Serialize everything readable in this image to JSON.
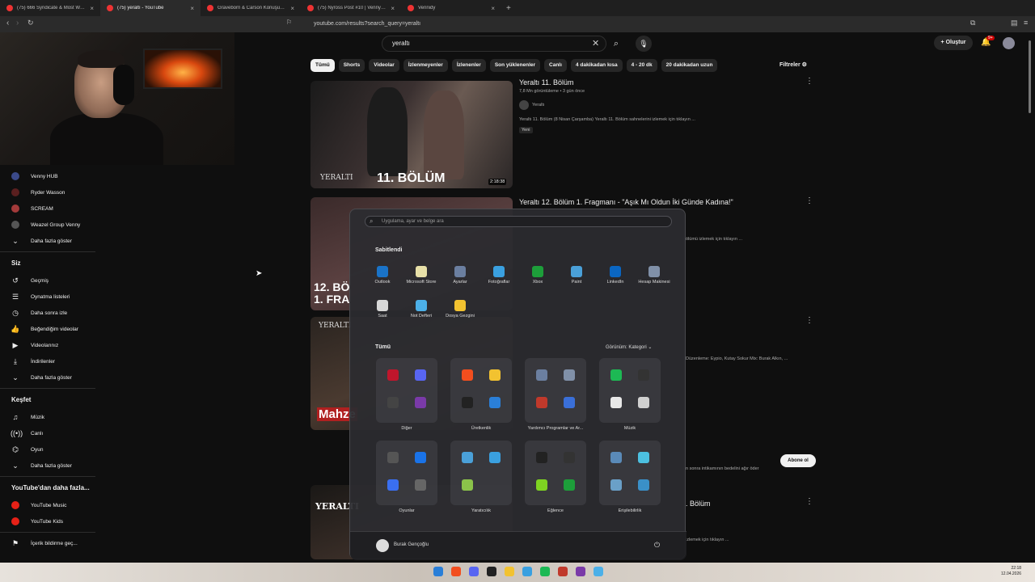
{
  "browser": {
    "tabs": [
      {
        "label": "(75) 666 Syndicate & Most Wanted | ...",
        "active": false
      },
      {
        "label": "(75) yeraltı - YouTube",
        "active": true
      },
      {
        "label": "Graveborn & Carson Konuşuyor! | R...",
        "active": false
      },
      {
        "label": "(75) Nyross Post #10 | VennyV - You...",
        "active": false
      },
      {
        "label": "Vennidy",
        "active": false
      }
    ],
    "url": "youtube.com/results?search_query=yeraltı"
  },
  "youtube": {
    "search_value": "yeraltı",
    "create_label": "Oluştur",
    "notifications_badge": "9+",
    "filter_chips": [
      "Tümü",
      "Shorts",
      "Videolar",
      "İzlenmeyenler",
      "İzlenenler",
      "Son yüklenenler",
      "Canlı",
      "4 dakikadan kısa",
      "4 - 20 dk",
      "20 dakikadan uzun"
    ],
    "filters_label": "Filtreler",
    "sidebar": {
      "subscriptions": [
        {
          "label": "Venny HUB",
          "color": "#3b4a8a"
        },
        {
          "label": "Ryder Wasson",
          "color": "#5a1f1f"
        },
        {
          "label": "SCREAM",
          "color": "#a33a3a"
        },
        {
          "label": "Weazel Group Venny",
          "color": "#555555"
        }
      ],
      "show_more_1": "Daha fazla göster",
      "you_title": "Siz",
      "you_items": [
        {
          "label": "Geçmiş",
          "icon": "history-icon",
          "glyph": "↺"
        },
        {
          "label": "Oynatma listeleri",
          "icon": "playlist-icon",
          "glyph": "☰"
        },
        {
          "label": "Daha sonra izle",
          "icon": "clock-icon",
          "glyph": "◷"
        },
        {
          "label": "Beğendiğim videolar",
          "icon": "thumbs-up-icon",
          "glyph": "👍"
        },
        {
          "label": "Videolarınız",
          "icon": "video-icon",
          "glyph": "▶"
        },
        {
          "label": "İndirilenler",
          "icon": "download-icon",
          "glyph": "⤓"
        }
      ],
      "show_more_2": "Daha fazla göster",
      "explore_title": "Keşfet",
      "explore_items": [
        {
          "label": "Müzik",
          "icon": "music-icon",
          "glyph": "♫"
        },
        {
          "label": "Canlı",
          "icon": "live-icon",
          "glyph": "((•))"
        },
        {
          "label": "Oyun",
          "icon": "gamepad-icon",
          "glyph": "⌬"
        }
      ],
      "show_more_3": "Daha fazla göster",
      "more_title": "YouTube'dan daha fazla...",
      "more_items": [
        {
          "label": "YouTube Music",
          "color": "#e62117"
        },
        {
          "label": "YouTube Kids",
          "color": "#e62117"
        }
      ],
      "report_label": "İçerik bildirme geç..."
    },
    "results": [
      {
        "title": "Yeraltı 11. Bölüm",
        "meta": "7,8 Mn görüntüleme • 3 gün önce",
        "channel": "Yeraltı",
        "desc": "Yeraltı 11. Bölüm (8 Nisan Çarşamba) Yeraltı 11. Bölüm sahnelerini izlemek için tıklayın ...",
        "badge": "Yeni",
        "duration": "2:18:38",
        "thumb_text": "11. BÖLÜM",
        "thumb_brand": "YERALTI"
      },
      {
        "title": "Yeraltı 12. Bölüm 1. Fragmanı - \"Aşık Mı Oldun İki Günde Kadına!\"",
        "desc": "ölümü izlemek için tıklayın ...",
        "thumb_text": "12. BÖ",
        "thumb_text2": "1. FRA"
      },
      {
        "desc": "Düzenleme: Eypio, Kutay Sokur Mix: Burak Alkın, ...",
        "thumb_brand": "YERALTI",
        "thumb_text": "Mahze"
      },
      {
        "desc": "n sonra intikamının bedelini ağır öder",
        "subscribe": "Abone ol"
      },
      {
        "title": ". Bölüm",
        "desc": "izlemek için tıklayın ...",
        "thumb_brand": "YERALTI"
      }
    ]
  },
  "start_menu": {
    "search_placeholder": "Uygulama, ayar ve belge ara",
    "pinned_title": "Sabitlendi",
    "pinned": [
      {
        "label": "Outlook",
        "color": "#1a73c8"
      },
      {
        "label": "Microsoft Store",
        "color": "#e8e0a8"
      },
      {
        "label": "Ayarlar",
        "color": "#6b7fa0"
      },
      {
        "label": "Fotoğraflar",
        "color": "#3aa0e0"
      },
      {
        "label": "Xbox",
        "color": "#1d9e3a"
      },
      {
        "label": "Paint",
        "color": "#4aa0d8"
      },
      {
        "label": "LinkedIn",
        "color": "#0a66c2"
      },
      {
        "label": "Hesap Makinesi",
        "color": "#8090a8"
      },
      {
        "label": "Saat",
        "color": "#d8d8d8"
      },
      {
        "label": "Not Defteri",
        "color": "#4cb0e8"
      },
      {
        "label": "Dosya Gezgini",
        "color": "#f2c230"
      }
    ],
    "all_title": "Tümü",
    "view_label": "Görünüm: Kategori",
    "categories": [
      {
        "label": "Diğer",
        "colors": [
          "#c0162c",
          "#5865f2",
          "#444444",
          "#7a3aa8"
        ]
      },
      {
        "label": "Üretkenlik",
        "colors": [
          "#f24e1e",
          "#f2c230",
          "#222222",
          "#2a7fd8"
        ]
      },
      {
        "label": "Yardımcı Programlar ve Ar...",
        "colors": [
          "#6b7fa0",
          "#8090a8",
          "#c0392b",
          "#3a6fd8"
        ]
      },
      {
        "label": "Müzik",
        "colors": [
          "#1db954",
          "#333333",
          "#e8e8e8",
          "#d0d0d0"
        ]
      },
      {
        "label": "Oyunlar",
        "colors": [
          "#555555",
          "#1a73e8",
          "#3a6ff0",
          "#666666"
        ]
      },
      {
        "label": "Yaratıcılık",
        "colors": [
          "#4aa0d8",
          "#3aa0e0",
          "#8bc34a",
          "#00000000"
        ]
      },
      {
        "label": "Eğlence",
        "colors": [
          "#222222",
          "#333333",
          "#7ed321",
          "#1d9e3a"
        ]
      },
      {
        "label": "Erişilebilirlik",
        "colors": [
          "#5a8ab8",
          "#4cc0e0",
          "#6aa0c8",
          "#3a90c8"
        ]
      }
    ],
    "user_name": "Burak Gençoğlu"
  },
  "taskbar": {
    "time": "22:18",
    "date": "12.04.2026",
    "icons": [
      {
        "name": "start-icon",
        "color": "#2a7fd8"
      },
      {
        "name": "brave-icon",
        "color": "#f24e1e"
      },
      {
        "name": "discord-icon",
        "color": "#5865f2"
      },
      {
        "name": "capcut-icon",
        "color": "#222222"
      },
      {
        "name": "explorer-icon",
        "color": "#f2c230"
      },
      {
        "name": "edge-icon",
        "color": "#3aa0e0"
      },
      {
        "name": "spotify-icon",
        "color": "#1db954"
      },
      {
        "name": "app-icon",
        "color": "#c0392b"
      },
      {
        "name": "app-icon",
        "color": "#7a3aa8"
      },
      {
        "name": "notepad-icon",
        "color": "#4cb0e8"
      }
    ]
  }
}
